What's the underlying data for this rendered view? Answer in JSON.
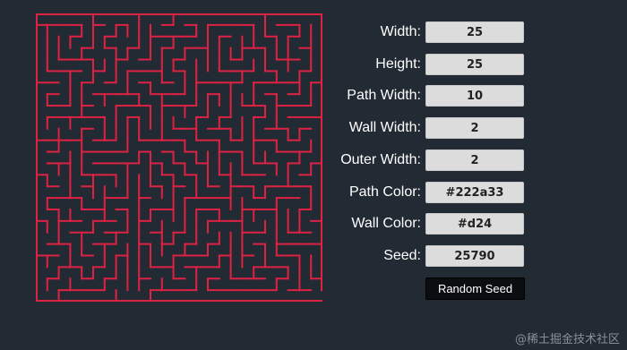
{
  "fields": [
    {
      "label": "Width:",
      "value": "25"
    },
    {
      "label": "Height:",
      "value": "25"
    },
    {
      "label": "Path Width:",
      "value": "10"
    },
    {
      "label": "Wall Width:",
      "value": "2"
    },
    {
      "label": "Outer Width:",
      "value": "2"
    },
    {
      "label": "Path Color:",
      "value": "#222a33"
    },
    {
      "label": "Wall Color:",
      "value": "#d24"
    },
    {
      "label": "Seed:",
      "value": "25790"
    }
  ],
  "random_seed_label": "Random Seed",
  "watermark": "@稀土掘金技术社区",
  "colors": {
    "path": "#222a33",
    "wall": "#d24",
    "button_bg": "#0b0d10"
  }
}
